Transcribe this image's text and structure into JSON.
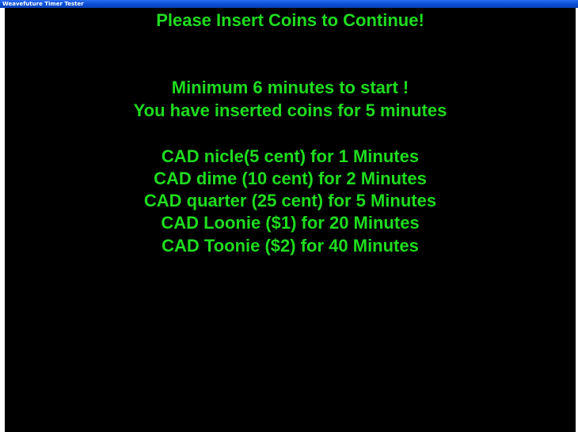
{
  "window": {
    "title": "Weavefuture Timer Tester"
  },
  "screen": {
    "headline": "Please Insert Coins to Continue!",
    "minimum_notice": "Minimum 6 minutes to start !",
    "inserted_status": "You have inserted coins for 5 minutes",
    "rates": [
      "CAD nicle(5 cent) for 1 Minutes",
      "CAD dime (10 cent) for 2 Minutes",
      "CAD quarter (25 cent) for 5 Minutes",
      "CAD Loonie ($1) for 20 Minutes",
      "CAD Toonie ($2) for 40 Minutes"
    ]
  },
  "colors": {
    "text": "#1fdc1f",
    "background": "#000000",
    "titlebar": "#0a4fd6"
  }
}
